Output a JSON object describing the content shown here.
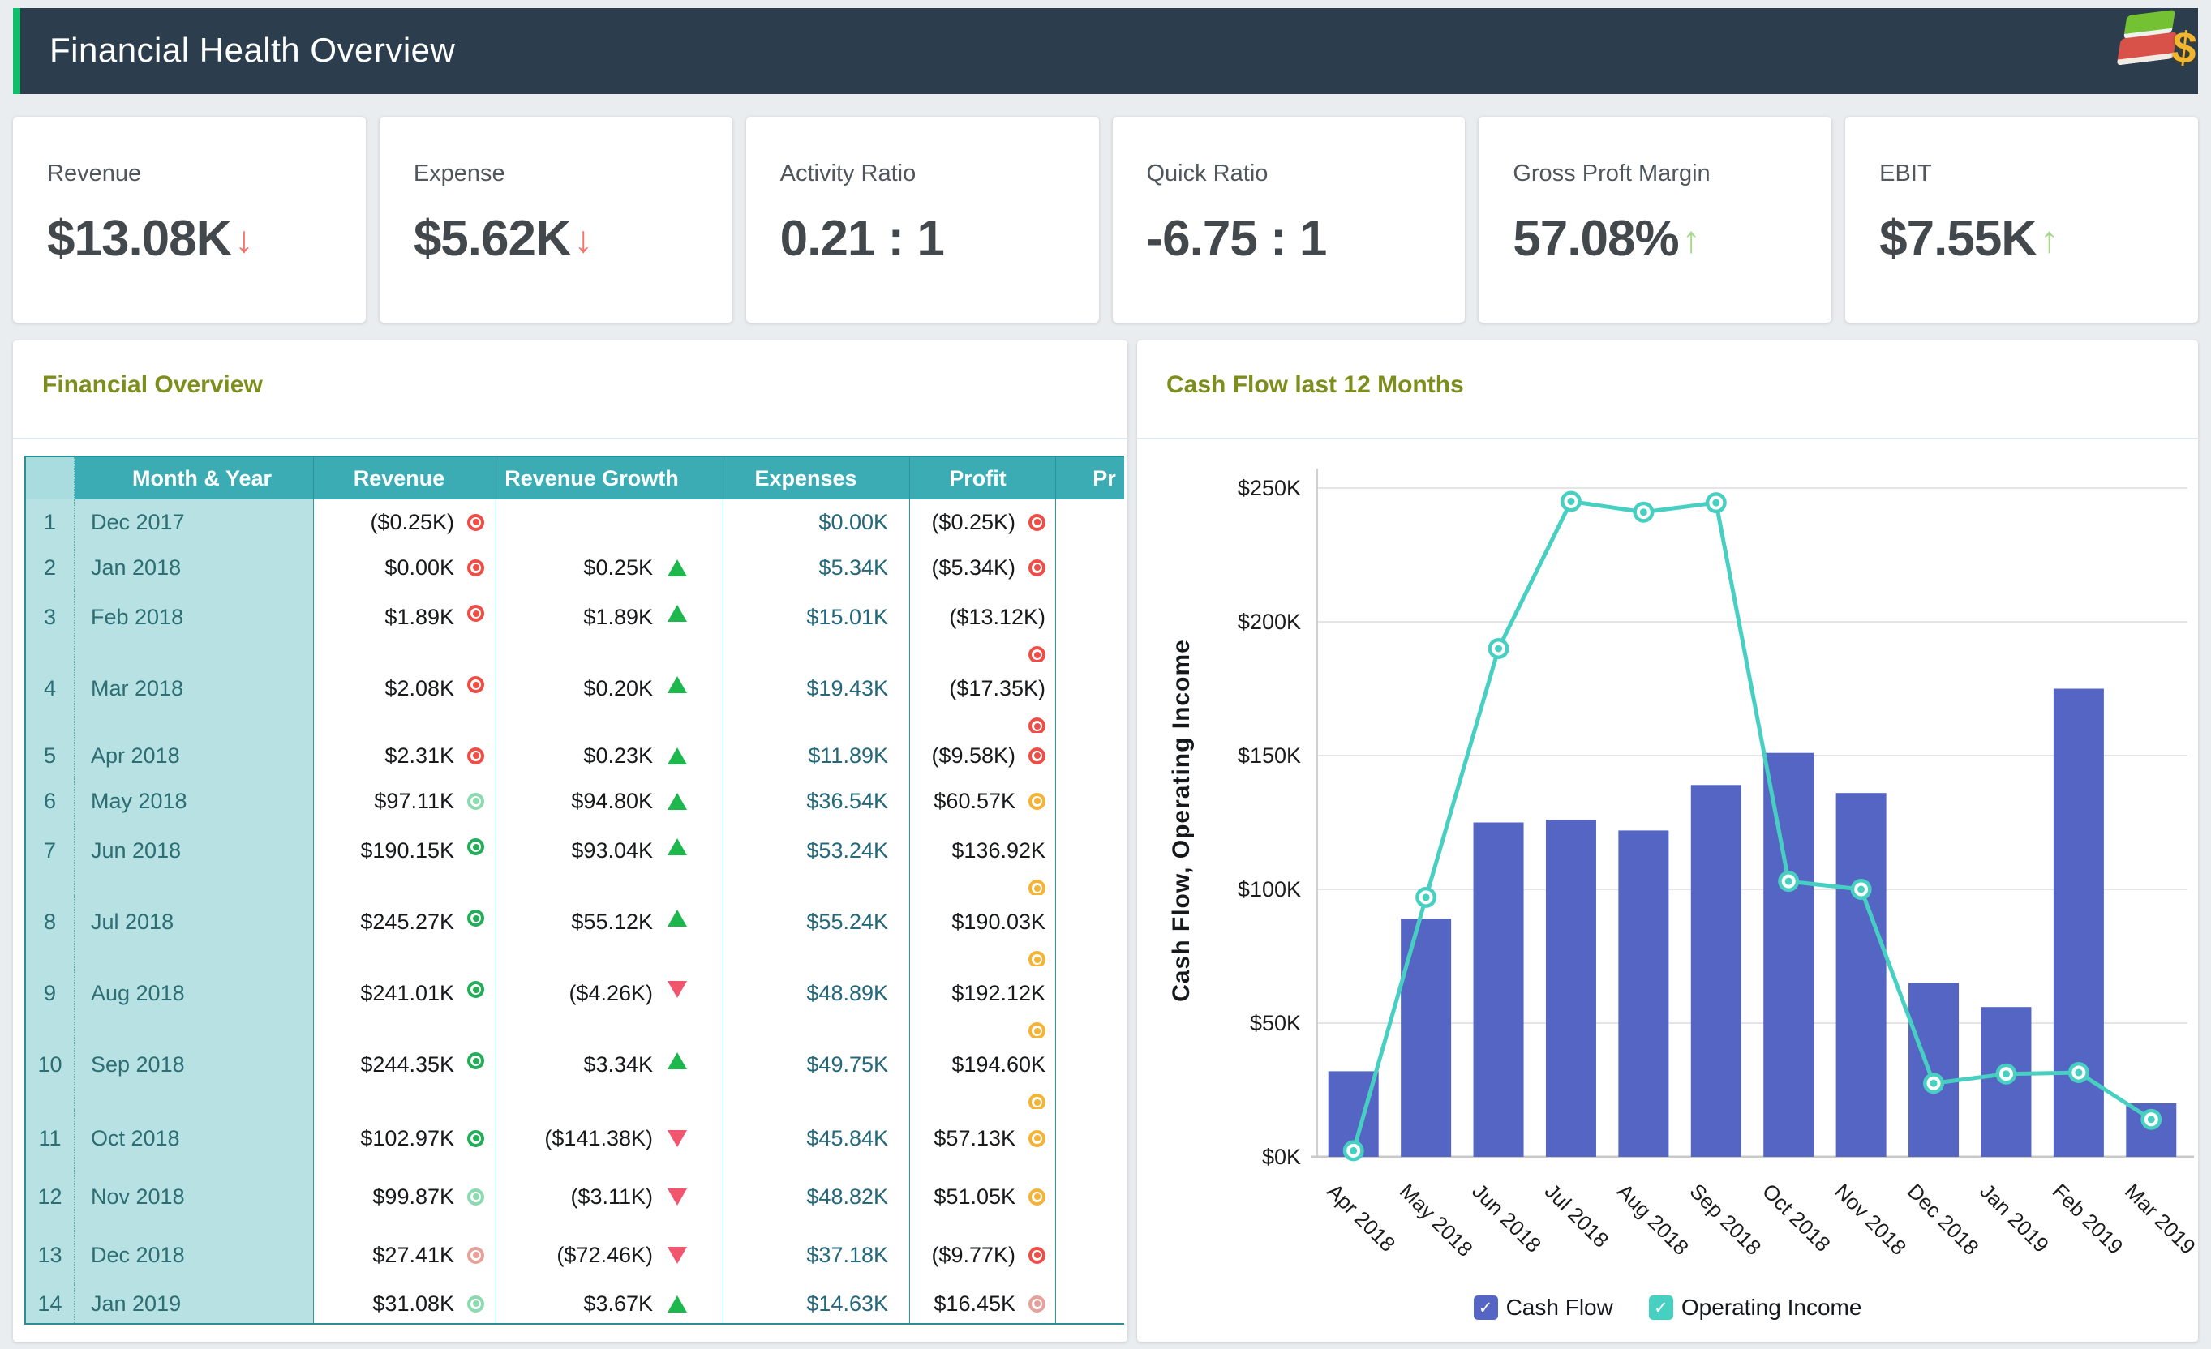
{
  "app": {
    "title": "Financial Health Overview"
  },
  "kpis": [
    {
      "label": "Revenue",
      "value": "$13.08K",
      "trend": "down"
    },
    {
      "label": "Expense",
      "value": "$5.62K",
      "trend": "down"
    },
    {
      "label": "Activity Ratio",
      "value": "0.21 : 1",
      "trend": ""
    },
    {
      "label": "Quick Ratio",
      "value": "-6.75 : 1",
      "trend": ""
    },
    {
      "label": "Gross Proft Margin",
      "value": "57.08%",
      "trend": "up"
    },
    {
      "label": "EBIT",
      "value": "$7.55K",
      "trend": "up"
    }
  ],
  "glyphs": {
    "down": "↓",
    "up": "↑",
    "check": "✓"
  },
  "table_panel": {
    "title": "Financial Overview",
    "headers": [
      "Month & Year",
      "Revenue",
      "Revenue Growth",
      "Expenses",
      "Profit",
      "Pr"
    ],
    "rows": [
      {
        "num": "1",
        "month": "Dec 2017",
        "revenue": "($0.25K)",
        "revenue_dot": "red",
        "growth": "",
        "growth_dir": "",
        "expenses": "$0.00K",
        "profit": "($0.25K)",
        "profit_dot": "red"
      },
      {
        "num": "2",
        "month": "Jan 2018",
        "revenue": "$0.00K",
        "revenue_dot": "red",
        "growth": "$0.25K",
        "growth_dir": "up",
        "expenses": "$5.34K",
        "profit": "($5.34K)",
        "profit_dot": "red"
      },
      {
        "num": "3",
        "month": "Feb 2018",
        "revenue": "$1.89K",
        "revenue_dot": "red",
        "growth": "$1.89K",
        "growth_dir": "up",
        "expenses": "$15.01K",
        "profit": "($13.12K)",
        "profit_dot": "red"
      },
      {
        "num": "4",
        "month": "Mar 2018",
        "revenue": "$2.08K",
        "revenue_dot": "red",
        "growth": "$0.20K",
        "growth_dir": "up",
        "expenses": "$19.43K",
        "profit": "($17.35K)",
        "profit_dot": "red"
      },
      {
        "num": "5",
        "month": "Apr 2018",
        "revenue": "$2.31K",
        "revenue_dot": "red",
        "growth": "$0.23K",
        "growth_dir": "up",
        "expenses": "$11.89K",
        "profit": "($9.58K)",
        "profit_dot": "red"
      },
      {
        "num": "6",
        "month": "May 2018",
        "revenue": "$97.11K",
        "revenue_dot": "pale-green",
        "growth": "$94.80K",
        "growth_dir": "up",
        "expenses": "$36.54K",
        "profit": "$60.57K",
        "profit_dot": "yellow"
      },
      {
        "num": "7",
        "month": "Jun 2018",
        "revenue": "$190.15K",
        "revenue_dot": "green",
        "growth": "$93.04K",
        "growth_dir": "up",
        "expenses": "$53.24K",
        "profit": "$136.92K",
        "profit_dot": "yellow"
      },
      {
        "num": "8",
        "month": "Jul 2018",
        "revenue": "$245.27K",
        "revenue_dot": "green",
        "growth": "$55.12K",
        "growth_dir": "up",
        "expenses": "$55.24K",
        "profit": "$190.03K",
        "profit_dot": "yellow"
      },
      {
        "num": "9",
        "month": "Aug 2018",
        "revenue": "$241.01K",
        "revenue_dot": "green",
        "growth": "($4.26K)",
        "growth_dir": "down",
        "expenses": "$48.89K",
        "profit": "$192.12K",
        "profit_dot": "yellow"
      },
      {
        "num": "10",
        "month": "Sep 2018",
        "revenue": "$244.35K",
        "revenue_dot": "green",
        "growth": "$3.34K",
        "growth_dir": "up",
        "expenses": "$49.75K",
        "profit": "$194.60K",
        "profit_dot": "yellow"
      },
      {
        "num": "11",
        "month": "Oct 2018",
        "revenue": "$102.97K",
        "revenue_dot": "green",
        "growth": "($141.38K)",
        "growth_dir": "down",
        "expenses": "$45.84K",
        "profit": "$57.13K",
        "profit_dot": "yellow"
      },
      {
        "num": "12",
        "month": "Nov 2018",
        "revenue": "$99.87K",
        "revenue_dot": "pale-green",
        "growth": "($3.11K)",
        "growth_dir": "down",
        "expenses": "$48.82K",
        "profit": "$51.05K",
        "profit_dot": "yellow"
      },
      {
        "num": "13",
        "month": "Dec 2018",
        "revenue": "$27.41K",
        "revenue_dot": "pale-red",
        "growth": "($72.46K)",
        "growth_dir": "down",
        "expenses": "$37.18K",
        "profit": "($9.77K)",
        "profit_dot": "red"
      },
      {
        "num": "14",
        "month": "Jan 2019",
        "revenue": "$31.08K",
        "revenue_dot": "pale-green",
        "growth": "$3.67K",
        "growth_dir": "up",
        "expenses": "$14.63K",
        "profit": "$16.45K",
        "profit_dot": "pale-red"
      }
    ]
  },
  "chart_panel": {
    "title": "Cash Flow last 12 Months"
  },
  "chart_data": {
    "type": "bar+line",
    "title": "Cash Flow last 12 Months",
    "categories": [
      "Apr 2018",
      "May 2018",
      "Jun 2018",
      "Jul 2018",
      "Aug 2018",
      "Sep 2018",
      "Oct 2018",
      "Nov 2018",
      "Dec 2018",
      "Jan 2019",
      "Feb 2019",
      "Mar 2019"
    ],
    "series": [
      {
        "name": "Cash Flow",
        "type": "bar",
        "color": "#5565c3",
        "values": [
          32,
          89,
          125,
          126,
          122,
          139,
          151,
          136,
          65,
          56,
          175,
          20
        ]
      },
      {
        "name": "Operating Income",
        "type": "line",
        "color": "#47d0c2",
        "values": [
          2.3,
          97,
          190,
          245,
          241,
          244.5,
          103,
          100,
          27.5,
          31,
          31.5,
          14
        ]
      }
    ],
    "units": "$K",
    "ylabel": "Cash Flow, Operating Income",
    "xlabel": "",
    "y_ticks": [
      "$0K",
      "$50K",
      "$100K",
      "$150K",
      "$200K",
      "$250K"
    ],
    "y_tick_values": [
      0,
      50,
      100,
      150,
      200,
      250
    ],
    "ylim": [
      0,
      256
    ],
    "grid": true,
    "legend_position": "bottom"
  },
  "colors": {
    "header_bg": "#2c3e4d",
    "header_accent": "#0fbe6b",
    "panel_title": "#7d8e1d",
    "table_header": "#3cacb4",
    "table_light_cell": "#b7e1e3",
    "status_red": "#ef4d46",
    "status_pale_red": "#e6a19b",
    "status_green": "#23ad58",
    "status_pale_green": "#8cdab0",
    "status_yellow": "#f5b334",
    "growth_up": "#1cb84e",
    "growth_down": "#f2566e",
    "kpi_down_arrow": "#f4736b",
    "kpi_up_arrow": "#a9d98e",
    "bar": "#5565c3",
    "line": "#47d0c2"
  }
}
